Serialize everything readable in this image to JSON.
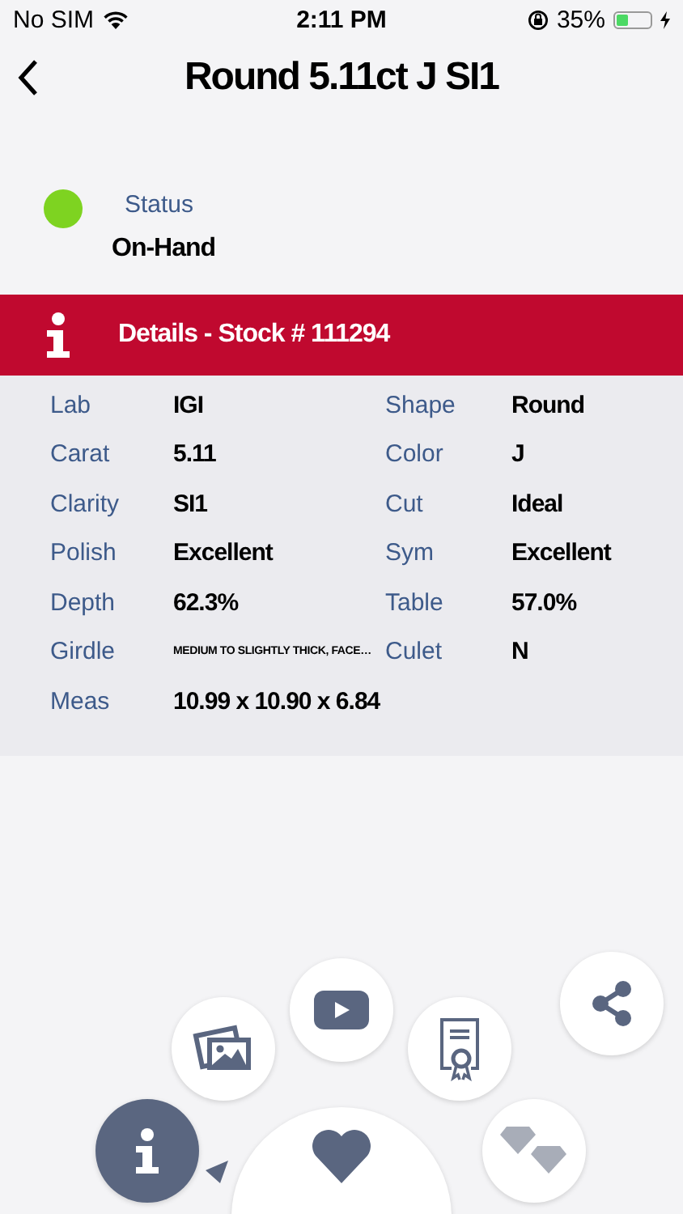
{
  "status_bar": {
    "carrier": "No SIM",
    "time": "2:11 PM",
    "battery": "35%"
  },
  "title": "Round 5.11ct J SI1",
  "status": {
    "label": "Status",
    "value": "On-Hand",
    "color": "#7ed321"
  },
  "details_header": "Details - Stock # 111294",
  "details": [
    {
      "label": "Lab",
      "value": "IGI",
      "label_2": "Shape",
      "value_2": "Round"
    },
    {
      "label": "Carat",
      "value": "5.11",
      "label_2": "Color",
      "value_2": "J"
    },
    {
      "label": "Clarity",
      "value": "SI1",
      "label_2": "Cut",
      "value_2": "Ideal"
    },
    {
      "label": "Polish",
      "value": "Excellent",
      "label_2": "Sym",
      "value_2": "Excellent"
    },
    {
      "label": "Depth",
      "value": "62.3%",
      "label_2": "Table",
      "value_2": "57.0%"
    },
    {
      "label": "Girdle",
      "value": "MEDIUM TO SLIGHTLY THICK, FACE…",
      "small": true,
      "label_2": "Culet",
      "value_2": "N"
    },
    {
      "label": "Meas",
      "value": "10.99 x 10.90 x 6.84"
    }
  ],
  "action_buttons": [
    {
      "kind": "gallery",
      "selected": false
    },
    {
      "kind": "video",
      "selected": false
    },
    {
      "kind": "certificate",
      "selected": false
    },
    {
      "kind": "share",
      "selected": false
    },
    {
      "kind": "diamonds",
      "selected": false
    },
    {
      "kind": "info",
      "selected": true
    },
    {
      "kind": "favorite",
      "selected": false
    }
  ]
}
